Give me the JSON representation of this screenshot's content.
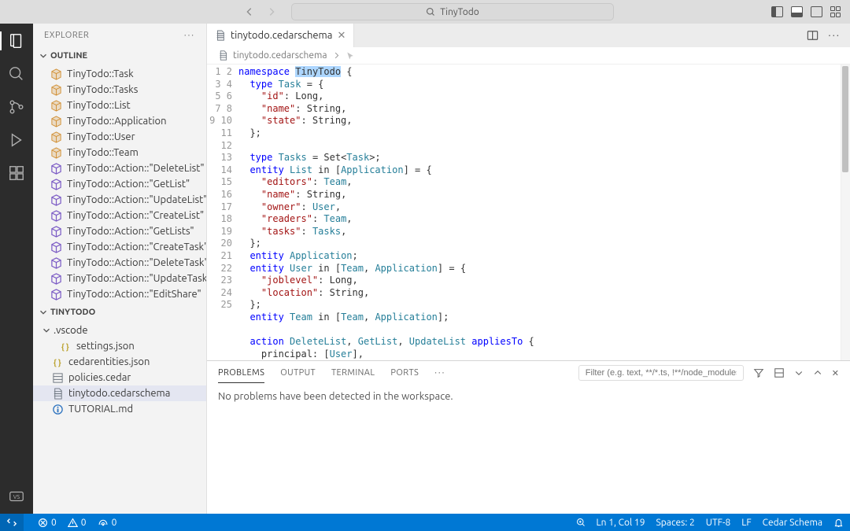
{
  "search": {
    "placeholder": "TinyTodo"
  },
  "explorer": {
    "title": "EXPLORER",
    "outline": {
      "label": "OUTLINE",
      "items": [
        {
          "label": "TinyTodo::Task",
          "kind": "class"
        },
        {
          "label": "TinyTodo::Tasks",
          "kind": "class"
        },
        {
          "label": "TinyTodo::List",
          "kind": "class"
        },
        {
          "label": "TinyTodo::Application",
          "kind": "class"
        },
        {
          "label": "TinyTodo::User",
          "kind": "class"
        },
        {
          "label": "TinyTodo::Team",
          "kind": "class"
        },
        {
          "label": "TinyTodo::Action::\"DeleteList\"",
          "kind": "module"
        },
        {
          "label": "TinyTodo::Action::\"GetList\"",
          "kind": "module"
        },
        {
          "label": "TinyTodo::Action::\"UpdateList\"",
          "kind": "module"
        },
        {
          "label": "TinyTodo::Action::\"CreateList\"",
          "kind": "module"
        },
        {
          "label": "TinyTodo::Action::\"GetLists\"",
          "kind": "module"
        },
        {
          "label": "TinyTodo::Action::\"CreateTask\"",
          "kind": "module"
        },
        {
          "label": "TinyTodo::Action::\"DeleteTask\"",
          "kind": "module"
        },
        {
          "label": "TinyTodo::Action::\"UpdateTask\"",
          "kind": "module"
        },
        {
          "label": "TinyTodo::Action::\"EditShare\"",
          "kind": "module"
        }
      ]
    },
    "project": {
      "label": "TINYTODO",
      "folders": [
        {
          "label": ".vscode",
          "children": [
            {
              "label": "settings.json",
              "kind": "json"
            }
          ]
        }
      ],
      "files": [
        {
          "label": "cedarentities.json",
          "kind": "json"
        },
        {
          "label": "policies.cedar",
          "kind": "cedar"
        },
        {
          "label": "tinytodo.cedarschema",
          "kind": "schema",
          "selected": true
        },
        {
          "label": "TUTORIAL.md",
          "kind": "md"
        }
      ]
    }
  },
  "tab": {
    "label": "tinytodo.cedarschema"
  },
  "breadcrumb": {
    "label": "tinytodo.cedarschema"
  },
  "panel": {
    "tabs": {
      "problems": "PROBLEMS",
      "output": "OUTPUT",
      "terminal": "TERMINAL",
      "ports": "PORTS"
    },
    "filter": "Filter (e.g. text, **/*.ts, !**/node_modules/**)",
    "msg": "No problems have been detected in the workspace."
  },
  "status": {
    "errors": "0",
    "warnings": "0",
    "ports": "0",
    "ln": "Ln 1, Col 19",
    "spaces": "Spaces: 2",
    "enc": "UTF-8",
    "eol": "LF",
    "lang": "Cedar Schema"
  },
  "code": {
    "lines": 25
  }
}
